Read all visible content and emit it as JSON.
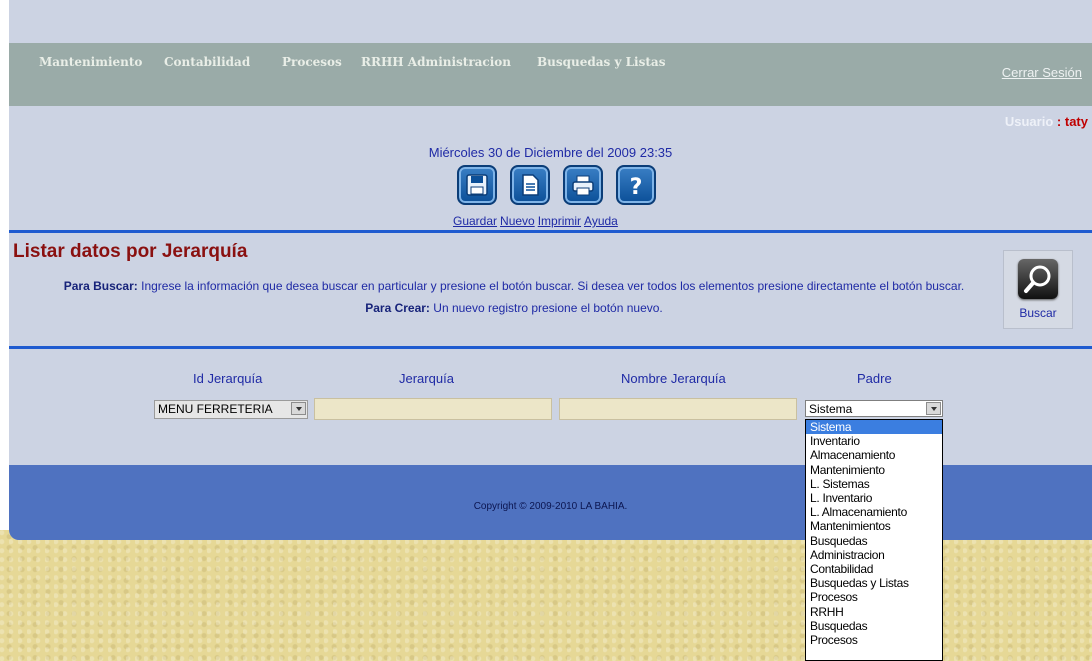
{
  "menu": {
    "items": [
      {
        "label": "Mantenimiento"
      },
      {
        "label": "Contabilidad"
      },
      {
        "label": "Procesos"
      },
      {
        "label": "RRHH Administracion"
      },
      {
        "label": "Busquedas y Listas"
      }
    ],
    "logout_label": "Cerrar Sesión"
  },
  "user": {
    "label": "Usuario",
    "separator": ":",
    "name": "taty"
  },
  "date_text": "Miércoles 30 de Diciembre del 2009 23:35",
  "toolbar": {
    "save_label": "Guardar",
    "new_label": "Nuevo",
    "print_label": "Imprimir",
    "help_label": "Ayuda"
  },
  "page": {
    "title": "Listar datos por Jerarquía",
    "search_bold": "Para Buscar:",
    "search_text": "Ingrese la información que desea buscar en particular y presione el botón buscar. Si desea ver todos los elementos presione directamente el botón buscar.",
    "create_bold": "Para Crear:",
    "create_text": "Un nuevo registro presione el botón nuevo.",
    "search_button_label": "Buscar"
  },
  "form": {
    "headers": {
      "id": "Id Jerarquía",
      "jerarquia": "Jerarquía",
      "nombre": "Nombre Jerarquía",
      "padre": "Padre"
    },
    "id_select_value": "MENU FERRETERIA",
    "jerarquia_value": "",
    "nombre_value": "",
    "padre_value": "Sistema",
    "padre_options": [
      "Sistema",
      "Inventario",
      "Almacenamiento",
      "Mantenimiento",
      "L. Sistemas",
      "L. Inventario",
      "L. Almacenamiento",
      "Mantenimientos",
      "Busquedas",
      "Administracion",
      "Contabilidad",
      "Busquedas y Listas",
      "Procesos",
      "RRHH",
      "Busquedas",
      "Procesos"
    ]
  },
  "footer": {
    "copyright": "Copyright © 2009-2010 LA BAHIA."
  },
  "colors": {
    "menubar": "#9aaba8",
    "divider": "#1f5bd0",
    "footer": "#4f72c0",
    "title": "#8a1010",
    "text": "#1f2aa5"
  }
}
